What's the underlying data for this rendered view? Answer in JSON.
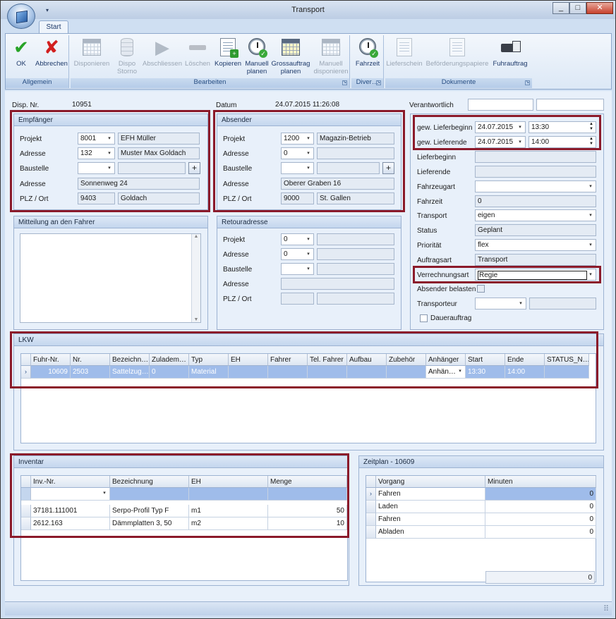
{
  "window": {
    "title": "Transport",
    "min": "_",
    "max": "□",
    "close": "✕"
  },
  "qat": "▾",
  "ribbon": {
    "tab": "Start",
    "groups": [
      {
        "label": "Allgemein",
        "buttons": [
          {
            "label": "OK",
            "icon": "checkmark-icon",
            "enabled": true
          },
          {
            "label": "Abbrechen",
            "icon": "cross-icon",
            "enabled": true
          }
        ]
      },
      {
        "label": "Bearbeiten",
        "buttons": [
          {
            "label": "Disponieren",
            "enabled": false
          },
          {
            "label": "Dispo Storno",
            "enabled": false
          },
          {
            "label": "Abschliessen",
            "enabled": false
          },
          {
            "label": "Löschen",
            "enabled": false
          },
          {
            "label": "Kopieren",
            "enabled": true
          },
          {
            "label": "Manuell planen",
            "enabled": true
          },
          {
            "label": "Grossauftrag planen",
            "enabled": true
          },
          {
            "label": "Manuell disponieren",
            "enabled": false
          }
        ]
      },
      {
        "label": "Diver…",
        "buttons": [
          {
            "label": "Fahrzeit",
            "enabled": true
          }
        ]
      },
      {
        "label": "Dokumente",
        "buttons": [
          {
            "label": "Lieferschein",
            "enabled": false
          },
          {
            "label": "Beförderungspapiere",
            "enabled": false
          },
          {
            "label": "Fuhrauftrag",
            "enabled": true
          }
        ]
      }
    ]
  },
  "header": {
    "disp_label": "Disp. Nr.",
    "disp_value": "10951",
    "datum_label": "Datum",
    "datum_value": "24.07.2015 11:26:08",
    "verantwortlich_label": "Verantwortlich"
  },
  "empfaenger": {
    "title": "Empfänger",
    "projekt_label": "Projekt",
    "projekt": "8001",
    "projekt_name": "EFH Müller",
    "adresse_label": "Adresse",
    "adresse": "132",
    "adresse_name": "Muster Max Goldach",
    "baustelle_label": "Baustelle",
    "strasse_label": "Adresse",
    "strasse": "Sonnenweg 24",
    "plz_label": "PLZ / Ort",
    "plz": "9403",
    "ort": "Goldach",
    "plus": "+"
  },
  "absender": {
    "title": "Absender",
    "projekt_label": "Projekt",
    "projekt": "1200",
    "projekt_name": "Magazin-Betrieb",
    "adresse_label": "Adresse",
    "adresse": "0",
    "baustelle_label": "Baustelle",
    "strasse_label": "Adresse",
    "strasse": "Oberer Graben 16",
    "plz_label": "PLZ / Ort",
    "plz": "9000",
    "ort": "St. Gallen",
    "plus": "+"
  },
  "mitteilung": {
    "title": "Mitteilung an den Fahrer",
    "up": "▲",
    "down": "▼"
  },
  "retour": {
    "title": "Retouradresse",
    "projekt_label": "Projekt",
    "projekt": "0",
    "adresse_label": "Adresse",
    "adresse": "0",
    "baustelle_label": "Baustelle",
    "strasse_label": "Adresse",
    "plz_label": "PLZ / Ort"
  },
  "right": {
    "lieferbeginn_label": "gew. Lieferbeginn",
    "lieferbeginn_date": "24.07.2015",
    "lieferbeginn_time": "13:30",
    "lieferende_label": "gew. Lieferende",
    "lieferende_date": "24.07.2015",
    "lieferende_time": "14:00",
    "lb_label": "Lieferbeginn",
    "le_label": "Lieferende",
    "fahrzeugart_label": "Fahrzeugart",
    "fahrzeit_label": "Fahrzeit",
    "fahrzeit": "0",
    "transport_label": "Transport",
    "transport": "eigen",
    "status_label": "Status",
    "status": "Geplant",
    "prioritaet_label": "Priorität",
    "prioritaet": "flex",
    "auftragsart_label": "Auftragsart",
    "auftragsart": "Transport",
    "verrechnungsart_label": "Verrechnungsart",
    "verrechnungsart": "Regie",
    "absender_belasten_label": "Absender belasten",
    "transporteur_label": "Transporteur",
    "dauerauftrag_label": "Dauerauftrag"
  },
  "lkw": {
    "title": "LKW",
    "columns": [
      "Fuhr-Nr.",
      "Nr.",
      "Bezeichn…",
      "Zuladem…",
      "Typ",
      "EH",
      "Fahrer",
      "Tel. Fahrer",
      "Aufbau",
      "Zubehör",
      "Anhänger",
      "Start",
      "Ende",
      "STATUS_N…"
    ],
    "rows": [
      [
        "10609",
        "2503",
        "Sattelzug…",
        "0",
        "Material",
        "",
        "",
        "",
        "",
        "",
        "Anhän…",
        "13:30",
        "14:00",
        ""
      ]
    ]
  },
  "inventar": {
    "title": "Inventar",
    "columns": [
      "Inv.-Nr.",
      "Bezeichnung",
      "EH",
      "Menge"
    ],
    "rows": [
      [
        "37181.111001",
        "Serpo-Profil Typ F",
        "m1",
        "50"
      ],
      [
        "2612.163",
        "Dämmplatten 3, 50",
        "m2",
        "10"
      ]
    ]
  },
  "zeitplan": {
    "title": "Zeitplan - 10609",
    "columns": [
      "Vorgang",
      "Minuten"
    ],
    "rows": [
      [
        "Fahren",
        "0"
      ],
      [
        "Laden",
        "0"
      ],
      [
        "Fahren",
        "0"
      ],
      [
        "Abladen",
        "0"
      ]
    ],
    "total": "0"
  },
  "glyphs": {
    "dd": "▾",
    "row_indicator": "›",
    "spin_up": "▲",
    "spin_down": "▼",
    "grip": "⠿"
  }
}
